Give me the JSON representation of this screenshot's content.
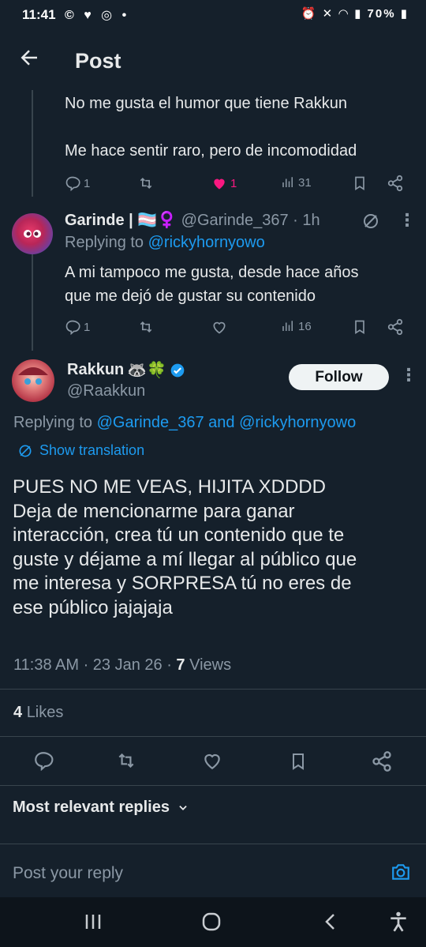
{
  "statusbar": {
    "time": "11:41",
    "left_icons": "© ♥ ◎ •",
    "battery": "70%"
  },
  "header": {
    "title": "Post"
  },
  "reply1": {
    "line1": "No me gusta el humor que tiene Rakkun",
    "line2": "Me hace sentir raro, pero de incomodidad",
    "replies": "1",
    "likes": "1",
    "views": "31",
    "like_color": "#f91880"
  },
  "reply2": {
    "name": "Garinde |",
    "flags": "🏳️‍⚧️♀️",
    "handle_time": "@Garinde_367 · 1h",
    "replying_prefix": "Replying to",
    "replying_to": "@rickyhornyowo",
    "text_line1": "A mi tampoco me gusta, desde hace años",
    "text_line2": "que me dejó de gustar su contenido",
    "replies": "1",
    "views": "16"
  },
  "main": {
    "name": "Rakkun",
    "emojis": "🦝🍀",
    "handle": "@Raakkun",
    "follow_label": "Follow",
    "replying_prefix": "Replying to",
    "replying_user1": "@Garinde_367",
    "replying_and": "and",
    "replying_user2": "@rickyhornyowo",
    "translation_label": "Show translation",
    "body_lines": [
      "PUES NO ME VEAS, HIJITA XDDDD",
      "Deja de mencionarme para ganar",
      "interacción, crea tú un contenido que te",
      "guste y déjame a mí llegar al público que",
      "me interesa y SORPRESA tú no eres de",
      "ese público jajajaja"
    ],
    "timestamp": "11:38 AM · 23 Jan 26 · ",
    "views_count": "7",
    "views_label": "Views",
    "likes_count": "4",
    "likes_label": "Likes"
  },
  "replies_sort": {
    "label": "Most relevant replies"
  },
  "composer": {
    "placeholder": "Post your reply"
  },
  "colors": {
    "background": "#15202b",
    "accent": "#1d9bf0",
    "verified": "#1d9bf0",
    "muted": "#8b98a5"
  }
}
